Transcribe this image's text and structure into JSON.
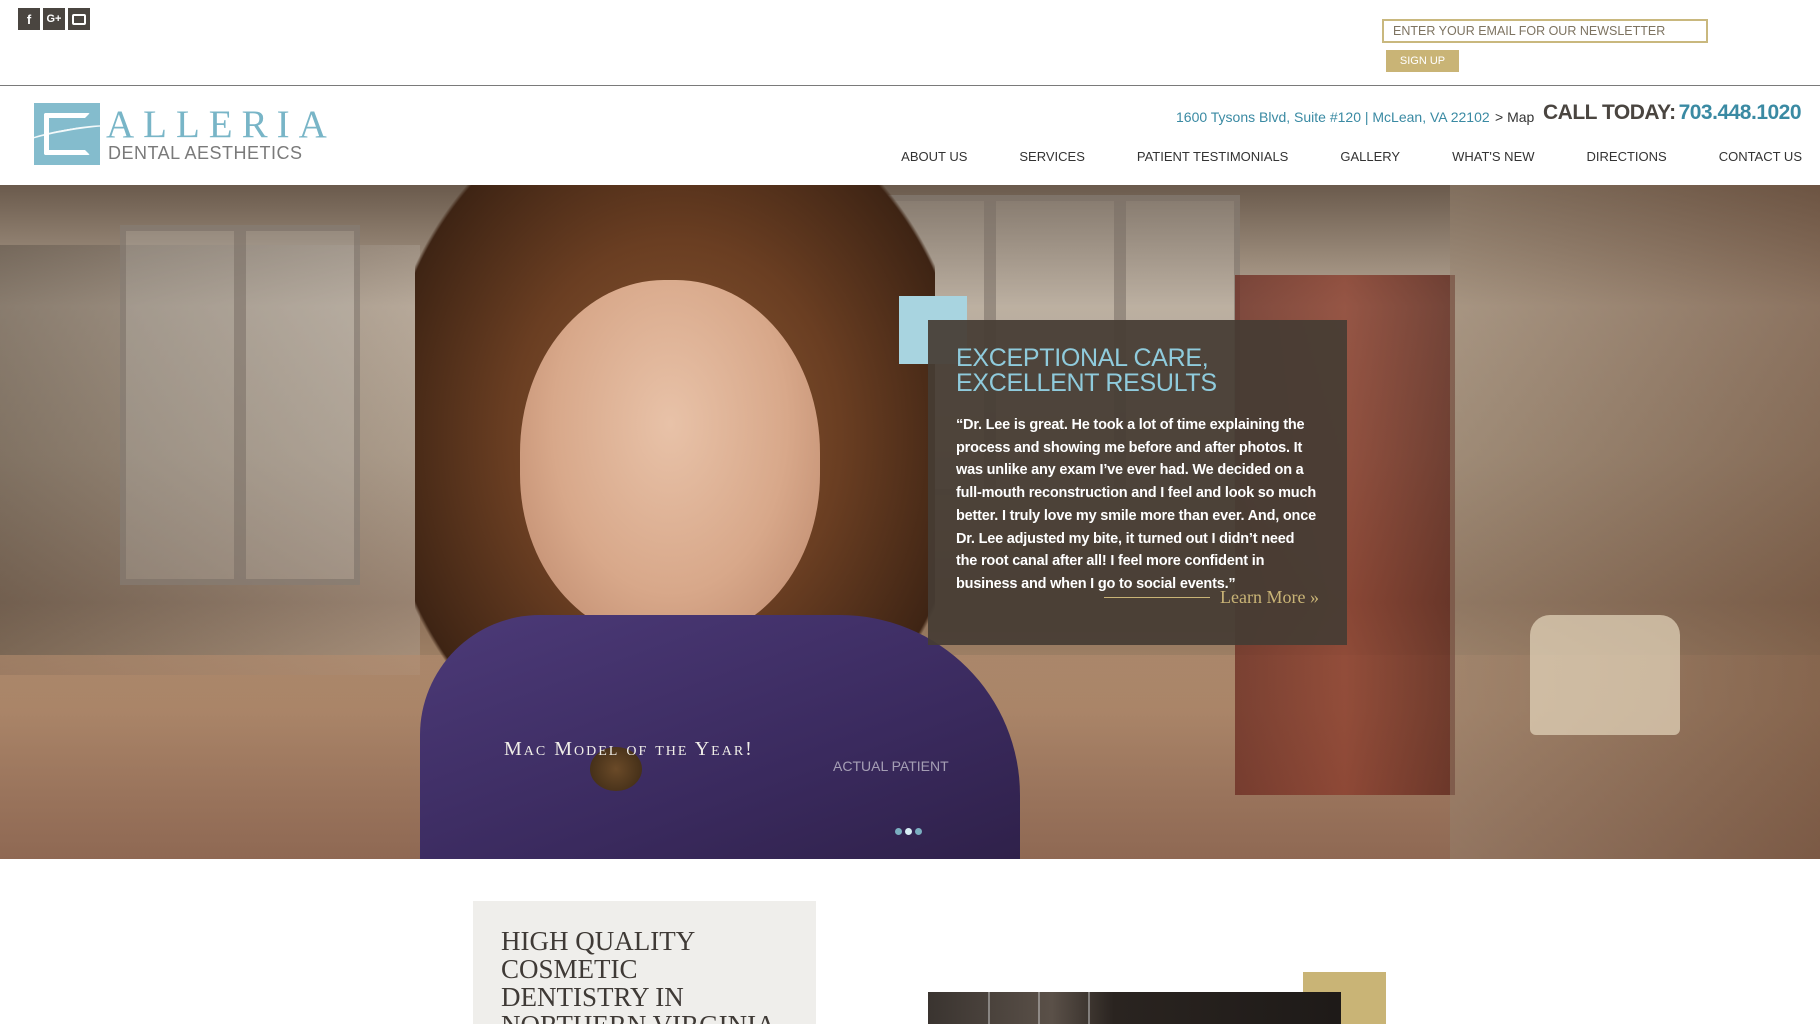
{
  "topbar": {
    "social": [
      {
        "name": "facebook-icon",
        "glyph": "f"
      },
      {
        "name": "google-plus-icon",
        "glyph": "G+"
      },
      {
        "name": "youtube-icon",
        "glyph": ""
      }
    ],
    "newsletter_placeholder": "ENTER YOUR EMAIL FOR OUR NEWSLETTER",
    "signup_label": "SIGN UP"
  },
  "header": {
    "logo_name": "ALLERIA",
    "logo_sub": "DENTAL AESTHETICS",
    "address": "1600 Tysons Blvd, Suite #120 | McLean, VA 22102",
    "map_link": "> Map",
    "call_label": "CALL TODAY:",
    "call_number": "703.448.1020",
    "nav": [
      "ABOUT US",
      "SERVICES",
      "PATIENT TESTIMONIALS",
      "GALLERY",
      "WHAT'S NEW",
      "DIRECTIONS",
      "CONTACT US"
    ]
  },
  "hero": {
    "caption": "Mac Model of the Year!",
    "actual_patient": "ACTUAL PATIENT",
    "quote_title_line1": "EXCEPTIONAL CARE,",
    "quote_title_line2": "EXCELLENT RESULTS",
    "quote_text": "“Dr. Lee is great. He took a lot of time explaining the process and showing me before and after photos. It was unlike any exam I’ve ever had. We decided on a full-mouth reconstruction and I feel and look so much better. I truly love my smile more than ever. And, once Dr. Lee adjusted my bite, it turned out I didn’t need the root canal after all! I feel more confident in business and when I go to social events.”",
    "learn_more": "Learn More »",
    "slide_count": 3,
    "active_slide": 2
  },
  "section": {
    "title": "HIGH QUALITY COSMETIC DENTISTRY IN NORTHERN VIRGINIA"
  },
  "colors": {
    "teal": "#3a8aa3",
    "light_teal": "#8fcbdc",
    "gold": "#c9b476",
    "dark_brown": "#4a4540"
  }
}
